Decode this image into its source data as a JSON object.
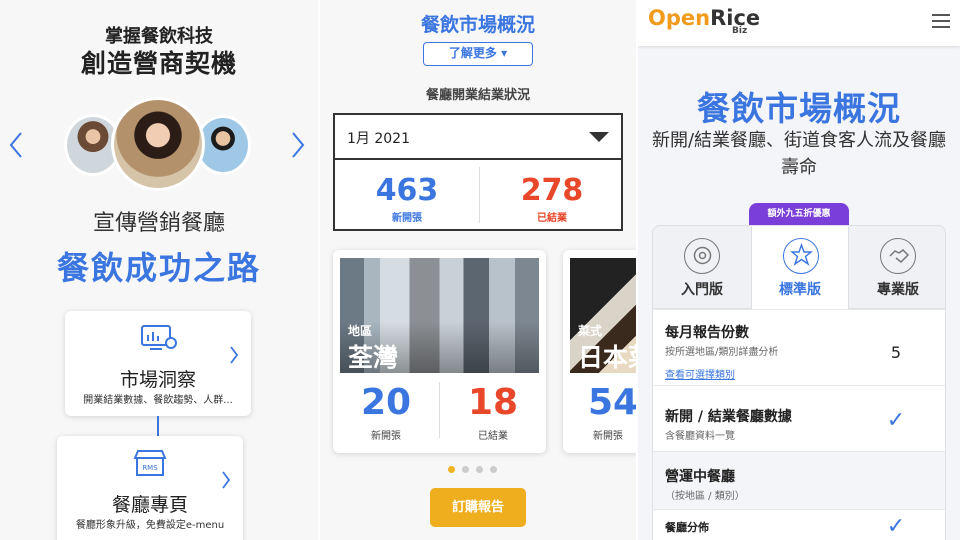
{
  "panel1": {
    "heading_line1": "掌握餐飲科技",
    "heading_line2": "創造營商契機",
    "prev_arrow": "‹",
    "next_arrow": "›",
    "subtitle": "宣傳營銷餐廳",
    "hero": "餐飲成功之路",
    "cards": [
      {
        "icon": "market-chart-icon",
        "title": "市場洞察",
        "description": "開業結業數據、餐飲趨勢、人群..."
      },
      {
        "icon": "rms-store-icon",
        "title": "餐廳專頁",
        "description": "餐廳形象升級，免費設定e-menu"
      }
    ],
    "accent_color": "#3b76e0"
  },
  "panel2": {
    "title": "餐飲市場概況",
    "more_button": "了解更多 ▾",
    "subtitle": "餐廳開業結業狀況",
    "month_select": "1月 2021",
    "opened": {
      "value": "463",
      "label": "新開張",
      "color": "#3b76e0"
    },
    "closed": {
      "value": "278",
      "label": "已結業",
      "color": "#e8472a"
    },
    "district_cards": [
      {
        "tag": "地區",
        "name": "荃灣",
        "opened": "20",
        "opened_label": "新開張",
        "closed": "18",
        "closed_label": "已結業"
      },
      {
        "tag": "菜式",
        "name": "日本菜",
        "opened": "54",
        "opened_label": "新開張"
      }
    ],
    "carousel_active_index": 0,
    "carousel_count": 4,
    "order_button": "訂購報告",
    "order_color": "#efae1e"
  },
  "panel3": {
    "logo_open": "Open",
    "logo_rice": "Rice",
    "logo_biz": "Biz",
    "title": "餐飲市場概況",
    "description": "新開/結業餐廳、街道食客人流及餐廳壽命",
    "promo": "額外九五折優惠",
    "plans": [
      {
        "name": "入門版",
        "icon": "gear-badge-icon",
        "selected": false
      },
      {
        "name": "標準版",
        "icon": "star-burst-icon",
        "selected": true
      },
      {
        "name": "專業版",
        "icon": "handshake-icon",
        "selected": false
      }
    ],
    "rows": [
      {
        "title": "每月報告份數",
        "desc": "按所選地區/類別詳盡分析",
        "link": "查看可選擇類別",
        "value": "5"
      },
      {
        "title": "新開 / 結業餐廳數據",
        "desc": "含餐廳資料一覽",
        "check": "✓"
      },
      {
        "title": "營運中餐廳",
        "desc": "（按地區 / 類別）"
      },
      {
        "title": "餐廳分佈",
        "check": "✓"
      }
    ]
  }
}
